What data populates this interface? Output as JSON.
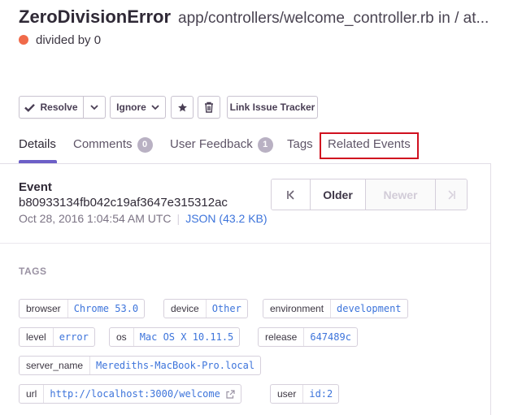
{
  "header": {
    "error_type": "ZeroDivisionError",
    "location": "app/controllers/welcome_controller.rb in / at...",
    "message": "divided by 0",
    "level_color": "#f06a4a"
  },
  "toolbar": {
    "resolve_label": "Resolve",
    "ignore_label": "Ignore",
    "link_tracker_label": "Link Issue Tracker"
  },
  "tabs": {
    "details": "Details",
    "comments": "Comments",
    "comments_count": "0",
    "user_feedback": "User Feedback",
    "user_feedback_count": "1",
    "tags": "Tags",
    "related_events": "Related Events",
    "active_color": "#6c5fc7",
    "highlight_color": "#d0101f"
  },
  "event": {
    "label": "Event",
    "id": "b80933134fb042c19af3647e315312ac",
    "date": "Oct 28, 2016 1:04:54 AM UTC",
    "separator": "|",
    "json_label": "JSON (43.2 KB)"
  },
  "pager": {
    "first_icon": "first-page-icon",
    "older": "Older",
    "newer": "Newer",
    "last_icon": "last-page-icon"
  },
  "tags_section": {
    "title": "TAGS",
    "items": [
      {
        "key": "browser",
        "value": "Chrome 53.0"
      },
      {
        "key": "device",
        "value": "Other"
      },
      {
        "key": "environment",
        "value": "development"
      },
      {
        "key": "level",
        "value": "error"
      },
      {
        "key": "os",
        "value": "Mac OS X 10.11.5"
      },
      {
        "key": "release",
        "value": "647489c"
      },
      {
        "key": "server_name",
        "value": "Merediths-MacBook-Pro.local"
      },
      {
        "key": "url",
        "value": "http://localhost:3000/welcome"
      },
      {
        "key": "user",
        "value": "id:2"
      }
    ]
  }
}
